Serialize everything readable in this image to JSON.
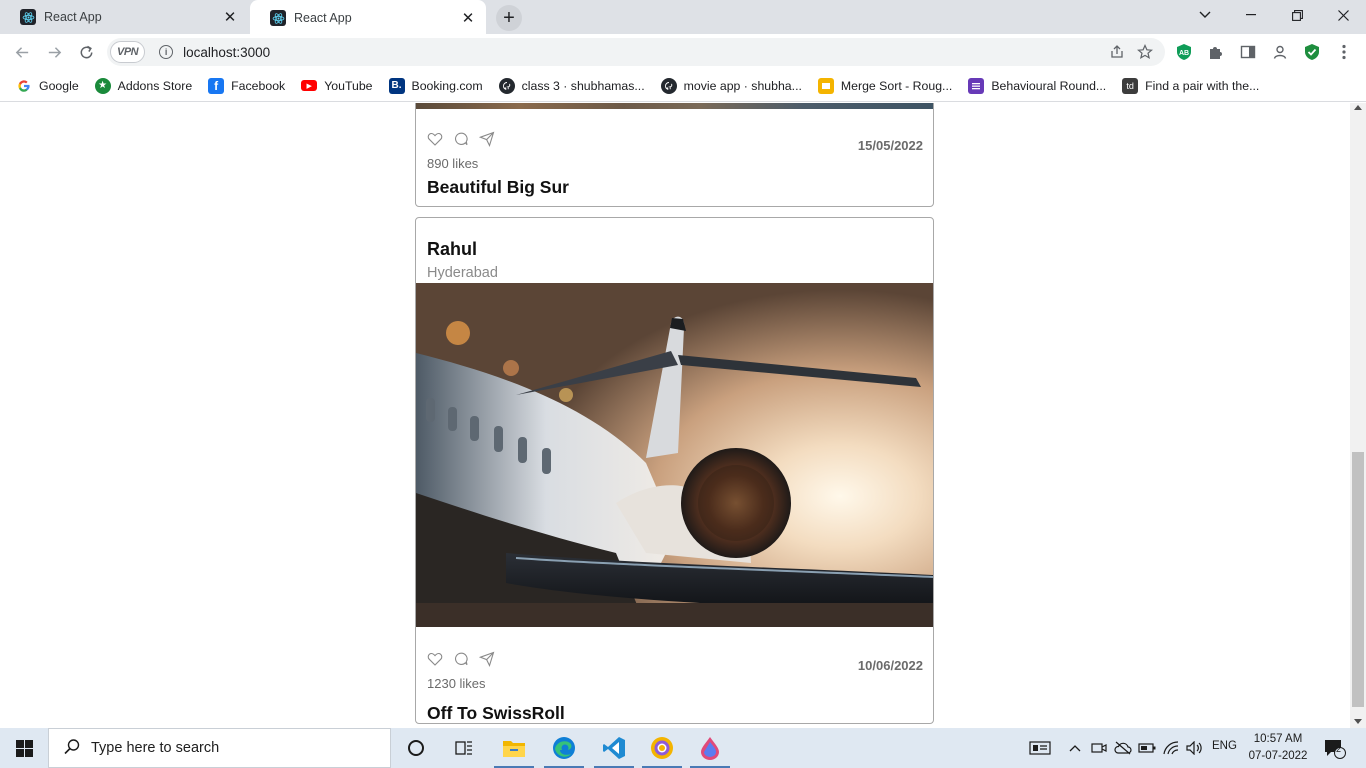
{
  "browser": {
    "tabs": [
      {
        "title": "React App"
      },
      {
        "title": "React App"
      }
    ],
    "url": "localhost:3000",
    "vpn_label": "VPN",
    "bookmarks": [
      {
        "label": "Google",
        "icon": "google-icon",
        "color": "#4285f4"
      },
      {
        "label": "Addons Store",
        "icon": "addons-store-icon",
        "color": "#1a8a3b"
      },
      {
        "label": "Facebook",
        "icon": "facebook-icon",
        "color": "#1877f2"
      },
      {
        "label": "YouTube",
        "icon": "youtube-icon",
        "color": "#ff0000"
      },
      {
        "label": "Booking.com",
        "icon": "booking-icon",
        "color": "#003580"
      },
      {
        "label": "class 3 · shubhamas...",
        "icon": "github-icon",
        "color": "#24292f"
      },
      {
        "label": "movie app · shubha...",
        "icon": "github-icon",
        "color": "#24292f"
      },
      {
        "label": "Merge Sort - Roug...",
        "icon": "slides-icon",
        "color": "#f4b400"
      },
      {
        "label": "Behavioural Round...",
        "icon": "forms-icon",
        "color": "#673ab7"
      },
      {
        "label": "Find a pair with the...",
        "icon": "td-icon",
        "color": "#3c3c3c"
      }
    ]
  },
  "feed": {
    "posts": [
      {
        "likes": "890 likes",
        "date": "15/05/2022",
        "caption": "Beautiful Big Sur"
      },
      {
        "author": "Rahul",
        "location": "Hyderabad",
        "likes": "1230 likes",
        "date": "10/06/2022",
        "caption": "Off To SwissRoll"
      }
    ]
  },
  "taskbar": {
    "search_placeholder": "Type here to search",
    "language": "ENG",
    "time": "10:57 AM",
    "date": "07-07-2022",
    "notification_count": "2"
  }
}
